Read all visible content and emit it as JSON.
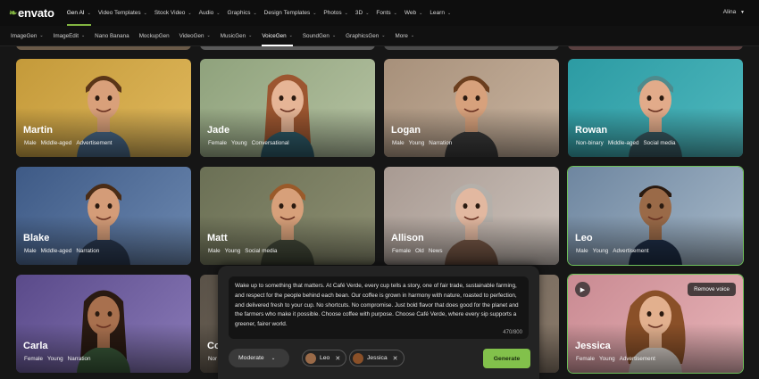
{
  "brand": "envato",
  "topnav": {
    "items": [
      {
        "label": "Gen AI",
        "chevron": true,
        "active": true
      },
      {
        "label": "Video Templates",
        "chevron": true
      },
      {
        "label": "Stock Video",
        "chevron": true
      },
      {
        "label": "Audio",
        "chevron": true
      },
      {
        "label": "Graphics",
        "chevron": true
      },
      {
        "label": "Design Templates",
        "chevron": true
      },
      {
        "label": "Photos",
        "chevron": true
      },
      {
        "label": "3D",
        "chevron": true
      },
      {
        "label": "Fonts",
        "chevron": true
      },
      {
        "label": "Web",
        "chevron": true
      },
      {
        "label": "Learn",
        "chevron": true
      }
    ],
    "user": "Alina"
  },
  "subnav": {
    "items": [
      {
        "label": "ImageGen",
        "chevron": true
      },
      {
        "label": "ImageEdit",
        "chevron": true
      },
      {
        "label": "Nano Banana",
        "chevron": false
      },
      {
        "label": "MockupGen",
        "chevron": false
      },
      {
        "label": "VideoGen",
        "chevron": true
      },
      {
        "label": "MusicGen",
        "chevron": true
      },
      {
        "label": "VoiceGen",
        "chevron": true,
        "active": true
      },
      {
        "label": "SoundGen",
        "chevron": true
      },
      {
        "label": "GraphicsGen",
        "chevron": true
      },
      {
        "label": "More",
        "chevron": true
      }
    ]
  },
  "voices": [
    {
      "name": "Martin",
      "tags": [
        "Male",
        "Middle-aged",
        "Advertisement"
      ],
      "bg": [
        "#c49a3a",
        "#e0b85c"
      ],
      "skin": "#d9a07a",
      "hair": "#5a3518",
      "shirt": "#4a6a8a",
      "hairStyle": "short"
    },
    {
      "name": "Jade",
      "tags": [
        "Female",
        "Young",
        "Conversational"
      ],
      "bg": [
        "#8fa27c",
        "#b5c2a2"
      ],
      "skin": "#e6b596",
      "hair": "#9c5630",
      "shirt": "#2f5d6b",
      "hairStyle": "long"
    },
    {
      "name": "Logan",
      "tags": [
        "Male",
        "Young",
        "Narration"
      ],
      "bg": [
        "#a7907a",
        "#c9b4a0"
      ],
      "skin": "#d7a17c",
      "hair": "#6b3e1e",
      "shirt": "#3c3c3c",
      "hairStyle": "short"
    },
    {
      "name": "Rowan",
      "tags": [
        "Non-binary",
        "Middle-aged",
        "Social media"
      ],
      "bg": [
        "#2c9ba3",
        "#4fb8be"
      ],
      "skin": "#e2ab8a",
      "hair": "#4f8a8c",
      "shirt": "#3a5b64",
      "hairStyle": "short"
    },
    {
      "name": "Blake",
      "tags": [
        "Male",
        "Middle-aged",
        "Narration"
      ],
      "bg": [
        "#3e5a86",
        "#6c88b0"
      ],
      "skin": "#d49c78",
      "hair": "#4a2c16",
      "shirt": "#2b3a52",
      "hairStyle": "short"
    },
    {
      "name": "Matt",
      "tags": [
        "Male",
        "Young",
        "Social media"
      ],
      "bg": [
        "#6b7055",
        "#8d8f72"
      ],
      "skin": "#d7a07a",
      "hair": "#9a5a2a",
      "shirt": "#444a3a",
      "hairStyle": "short"
    },
    {
      "name": "Allison",
      "tags": [
        "Female",
        "Old",
        "News"
      ],
      "bg": [
        "#a89a92",
        "#cdc3bc"
      ],
      "skin": "#e2b8a0",
      "hair": "#b5b0aa",
      "shirt": "#7a5a48",
      "hairStyle": "bob"
    },
    {
      "name": "Leo",
      "tags": [
        "Male",
        "Young",
        "Advertisement"
      ],
      "bg": [
        "#6e86a0",
        "#a6b8c8"
      ],
      "skin": "#9a6a48",
      "hair": "#2a1a10",
      "shirt": "#1f2f48",
      "hairStyle": "buzz"
    },
    {
      "name": "Carla",
      "tags": [
        "Female",
        "Young",
        "Narration"
      ],
      "bg": [
        "#5a4a8a",
        "#8a7ab8"
      ],
      "skin": "#a8704e",
      "hair": "#2a1a12",
      "shirt": "#3a5a3a",
      "hairStyle": "long"
    },
    {
      "name": "Co",
      "tags": [
        "Nor"
      ],
      "bg": [
        "#5a5248",
        "#7a6e60"
      ],
      "skin": "#d9a07a",
      "hair": "#4a3020",
      "shirt": "#3a3a3a",
      "hairStyle": "short"
    },
    {
      "name": "",
      "tags": [],
      "bg": [
        "#6a6056",
        "#8a7a6a"
      ],
      "skin": "#d9a07a",
      "hair": "#4a3020",
      "shirt": "#3a3a3a",
      "hairStyle": "short"
    },
    {
      "name": "Jessica",
      "tags": [
        "Female",
        "Young",
        "Advertisement"
      ],
      "bg": [
        "#c98a92",
        "#e8b4b8"
      ],
      "skin": "#e2b08e",
      "hair": "#8a5028",
      "shirt": "#d8d0c8",
      "hairStyle": "curly"
    }
  ],
  "selected_card": {
    "play_icon": "play-icon",
    "remove_label": "Remove voice"
  },
  "panel": {
    "text": "Wake up to something that matters. At Café Verde, every cup tells a story, one of fair trade, sustainable farming, and respect for the people behind each bean. Our coffee is grown in harmony with nature, roasted to perfection, and delivered fresh to your cup. No shortcuts. No compromise. Just bold flavor that does good for the planet and the farmers who make it possible. Choose coffee with purpose. Choose Café Verde, where every sip supports a greener, fairer world.",
    "char_count": "470/800",
    "tone": "Moderate",
    "chips": [
      {
        "name": "Leo",
        "color": "#9a6a48"
      },
      {
        "name": "Jessica",
        "color": "#8a5028"
      }
    ],
    "generate_label": "Generate"
  },
  "colors": {
    "accent": "#82b541",
    "generate": "#82c14b",
    "selected_outline": "#6ec05a"
  }
}
